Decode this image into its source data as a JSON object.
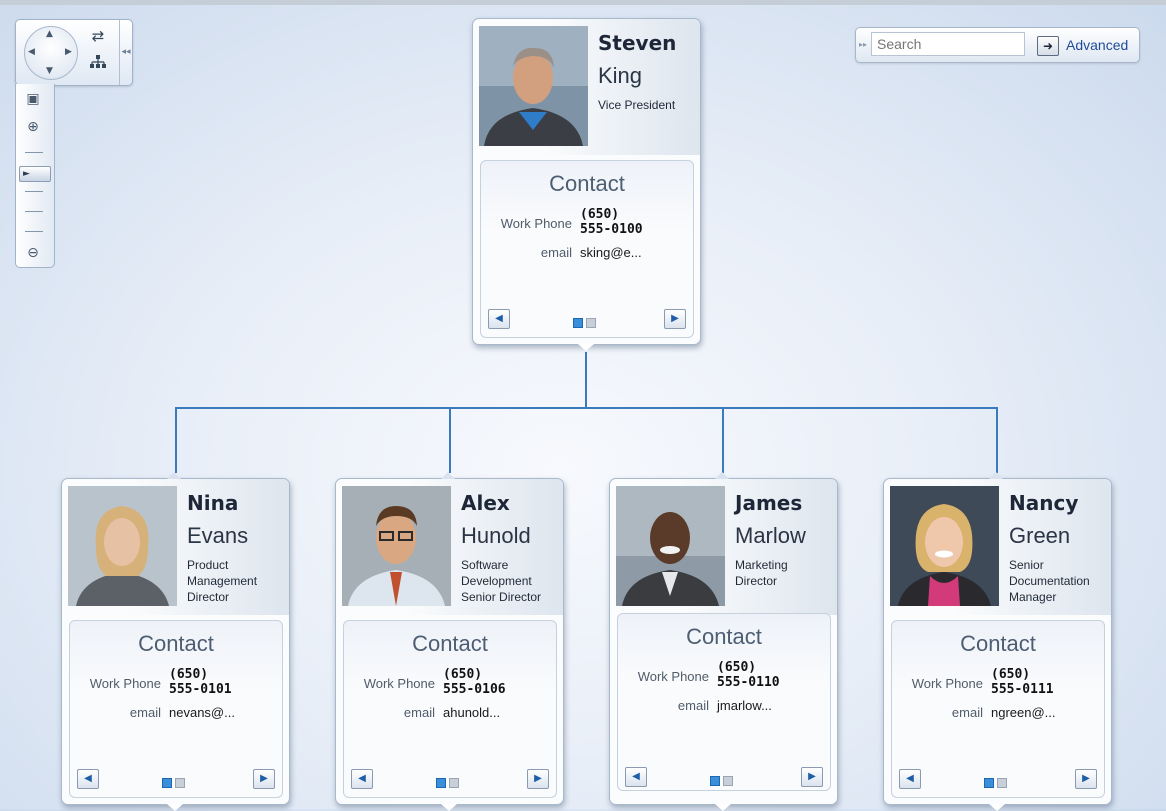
{
  "toolbar": {
    "search_placeholder": "Search",
    "advanced_label": "Advanced",
    "icons": [
      "pan-control-icon",
      "swap-layout-icon",
      "hierarchy-layout-icon",
      "zoom-fit-icon",
      "zoom-in-icon",
      "zoom-out-icon"
    ]
  },
  "contact_heading": "Contact",
  "labels": {
    "work_phone": "Work Phone",
    "email": "email"
  },
  "people": [
    {
      "first": "Steven",
      "last": "King",
      "title": "Vice President",
      "phone_area": "(650)",
      "phone_num": "555-0100",
      "email": "sking@e..."
    },
    {
      "first": "Nina",
      "last": "Evans",
      "title": "Product Management Director",
      "phone_area": "(650)",
      "phone_num": "555-0101",
      "email": "nevans@..."
    },
    {
      "first": "Alex",
      "last": "Hunold",
      "title": "Software Development Senior Director",
      "phone_area": "(650)",
      "phone_num": "555-0106",
      "email": "ahunold..."
    },
    {
      "first": "James",
      "last": "Marlow",
      "title": "Marketing Director",
      "phone_area": "(650)",
      "phone_num": "555-0110",
      "email": "jmarlow..."
    },
    {
      "first": "Nancy",
      "last": "Green",
      "title": "Senior Documentation Manager",
      "phone_area": "(650)",
      "phone_num": "555-0111",
      "email": "ngreen@..."
    }
  ],
  "colors": {
    "connector": "#3a7bc0",
    "page_dot_active": "#3a8fdb"
  }
}
